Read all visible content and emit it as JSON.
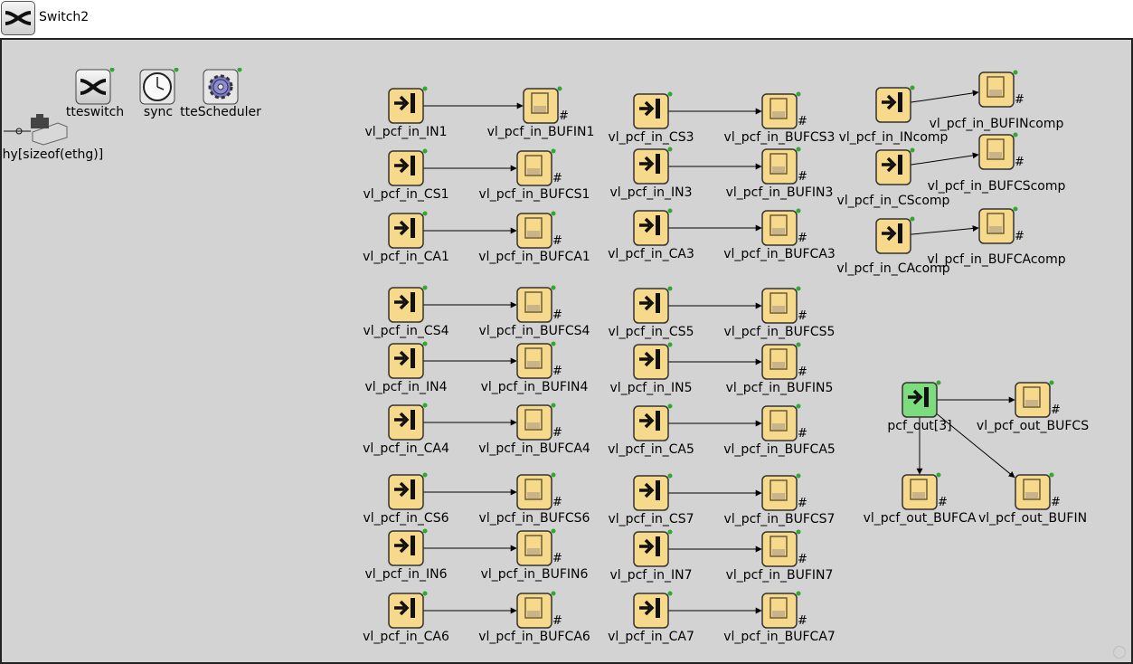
{
  "window": {
    "title": "Switch2"
  },
  "icons": {
    "source": "vl-input-icon",
    "buffer": "buffer-queue-icon",
    "switch": "shuffle-switch-icon",
    "sync": "clock-icon",
    "scheduler": "gear-icon",
    "phy": "ethernet-interface-icon"
  },
  "colors": {
    "canvas": "#d3d3d3",
    "module": "#f6d98a",
    "module_green": "#7ddc7d",
    "status_dot": "#2eaa2e"
  },
  "top_modules": [
    {
      "id": "tteswitch",
      "label": "tteswitch",
      "icon": "shuffle-switch-icon"
    },
    {
      "id": "sync",
      "label": "sync",
      "icon": "clock-icon"
    },
    {
      "id": "tteScheduler",
      "label": "tteScheduler",
      "icon": "gear-icon"
    },
    {
      "id": "phy",
      "label": "phy[sizeof(ethg)]",
      "icon": "ethernet-interface-icon"
    }
  ],
  "nodes": [
    {
      "id": "in_IN1",
      "label": "vl_pcf_in_IN1",
      "kind": "source"
    },
    {
      "id": "buf_IN1",
      "label": "vl_pcf_in_BUFIN1",
      "kind": "buffer"
    },
    {
      "id": "in_CS1",
      "label": "vl_pcf_in_CS1",
      "kind": "source"
    },
    {
      "id": "buf_CS1",
      "label": "vl_pcf_in_BUFCS1",
      "kind": "buffer"
    },
    {
      "id": "in_CA1",
      "label": "vl_pcf_in_CA1",
      "kind": "source"
    },
    {
      "id": "buf_CA1",
      "label": "vl_pcf_in_BUFCA1",
      "kind": "buffer"
    },
    {
      "id": "in_CS4",
      "label": "vl_pcf_in_CS4",
      "kind": "source"
    },
    {
      "id": "buf_CS4",
      "label": "vl_pcf_in_BUFCS4",
      "kind": "buffer"
    },
    {
      "id": "in_IN4",
      "label": "vl_pcf_in_IN4",
      "kind": "source"
    },
    {
      "id": "buf_IN4",
      "label": "vl_pcf_in_BUFIN4",
      "kind": "buffer"
    },
    {
      "id": "in_CA4",
      "label": "vl_pcf_in_CA4",
      "kind": "source"
    },
    {
      "id": "buf_CA4",
      "label": "vl_pcf_in_BUFCA4",
      "kind": "buffer"
    },
    {
      "id": "in_CS6",
      "label": "vl_pcf_in_CS6",
      "kind": "source"
    },
    {
      "id": "buf_CS6",
      "label": "vl_pcf_in_BUFCS6",
      "kind": "buffer"
    },
    {
      "id": "in_IN6",
      "label": "vl_pcf_in_IN6",
      "kind": "source"
    },
    {
      "id": "buf_IN6",
      "label": "vl_pcf_in_BUFIN6",
      "kind": "buffer"
    },
    {
      "id": "in_CA6",
      "label": "vl_pcf_in_CA6",
      "kind": "source"
    },
    {
      "id": "buf_CA6",
      "label": "vl_pcf_in_BUFCA6",
      "kind": "buffer"
    },
    {
      "id": "in_CS3",
      "label": "vl_pcf_in_CS3",
      "kind": "source"
    },
    {
      "id": "buf_CS3",
      "label": "vl_pcf_in_BUFCS3",
      "kind": "buffer"
    },
    {
      "id": "in_IN3",
      "label": "vl_pcf_in_IN3",
      "kind": "source"
    },
    {
      "id": "buf_IN3",
      "label": "vl_pcf_in_BUFIN3",
      "kind": "buffer"
    },
    {
      "id": "in_CA3",
      "label": "vl_pcf_in_CA3",
      "kind": "source"
    },
    {
      "id": "buf_CA3",
      "label": "vl_pcf_in_BUFCA3",
      "kind": "buffer"
    },
    {
      "id": "in_CS5",
      "label": "vl_pcf_in_CS5",
      "kind": "source"
    },
    {
      "id": "buf_CS5",
      "label": "vl_pcf_in_BUFCS5",
      "kind": "buffer"
    },
    {
      "id": "in_IN5",
      "label": "vl_pcf_in_IN5",
      "kind": "source"
    },
    {
      "id": "buf_IN5",
      "label": "vl_pcf_in_BUFIN5",
      "kind": "buffer"
    },
    {
      "id": "in_CA5",
      "label": "vl_pcf_in_CA5",
      "kind": "source"
    },
    {
      "id": "buf_CA5",
      "label": "vl_pcf_in_BUFCA5",
      "kind": "buffer"
    },
    {
      "id": "in_CS7",
      "label": "vl_pcf_in_CS7",
      "kind": "source"
    },
    {
      "id": "buf_CS7",
      "label": "vl_pcf_in_BUFCS7",
      "kind": "buffer"
    },
    {
      "id": "in_IN7",
      "label": "vl_pcf_in_IN7",
      "kind": "source"
    },
    {
      "id": "buf_IN7",
      "label": "vl_pcf_in_BUFIN7",
      "kind": "buffer"
    },
    {
      "id": "in_CA7",
      "label": "vl_pcf_in_CA7",
      "kind": "source"
    },
    {
      "id": "buf_CA7",
      "label": "vl_pcf_in_BUFCA7",
      "kind": "buffer"
    },
    {
      "id": "in_INcomp",
      "label": "vl_pcf_in_INcomp",
      "kind": "source"
    },
    {
      "id": "buf_INcomp",
      "label": "vl_pcf_in_BUFINcomp",
      "kind": "buffer"
    },
    {
      "id": "in_CScomp",
      "label": "vl_pcf_in_CScomp",
      "kind": "source"
    },
    {
      "id": "buf_CScomp",
      "label": "vl_pcf_in_BUFCScomp",
      "kind": "buffer"
    },
    {
      "id": "in_CAcomp",
      "label": "vl_pcf_in_CAcomp",
      "kind": "source"
    },
    {
      "id": "buf_CAcomp",
      "label": "vl_pcf_in_BUFCAcomp",
      "kind": "buffer"
    },
    {
      "id": "pcf_out",
      "label": "pcf_out[3]",
      "kind": "source_green"
    },
    {
      "id": "out_BUFCS",
      "label": "vl_pcf_out_BUFCS",
      "kind": "buffer"
    },
    {
      "id": "out_BUFCA",
      "label": "vl_pcf_out_BUFCA",
      "kind": "buffer"
    },
    {
      "id": "out_BUFIN",
      "label": "vl_pcf_out_BUFIN",
      "kind": "buffer"
    }
  ],
  "connections": [
    [
      "in_IN1",
      "buf_IN1"
    ],
    [
      "in_CS1",
      "buf_CS1"
    ],
    [
      "in_CA1",
      "buf_CA1"
    ],
    [
      "in_CS4",
      "buf_CS4"
    ],
    [
      "in_IN4",
      "buf_IN4"
    ],
    [
      "in_CA4",
      "buf_CA4"
    ],
    [
      "in_CS6",
      "buf_CS6"
    ],
    [
      "in_IN6",
      "buf_IN6"
    ],
    [
      "in_CA6",
      "buf_CA6"
    ],
    [
      "in_CS3",
      "buf_CS3"
    ],
    [
      "in_IN3",
      "buf_IN3"
    ],
    [
      "in_CA3",
      "buf_CA3"
    ],
    [
      "in_CS5",
      "buf_CS5"
    ],
    [
      "in_IN5",
      "buf_IN5"
    ],
    [
      "in_CA5",
      "buf_CA5"
    ],
    [
      "in_CS7",
      "buf_CS7"
    ],
    [
      "in_IN7",
      "buf_IN7"
    ],
    [
      "in_CA7",
      "buf_CA7"
    ],
    [
      "in_INcomp",
      "buf_INcomp"
    ],
    [
      "in_CScomp",
      "buf_CScomp"
    ],
    [
      "in_CAcomp",
      "buf_CAcomp"
    ],
    [
      "pcf_out",
      "out_BUFCS"
    ],
    [
      "pcf_out",
      "out_BUFCA"
    ],
    [
      "pcf_out",
      "out_BUFIN"
    ]
  ],
  "buffer_marker": "#"
}
